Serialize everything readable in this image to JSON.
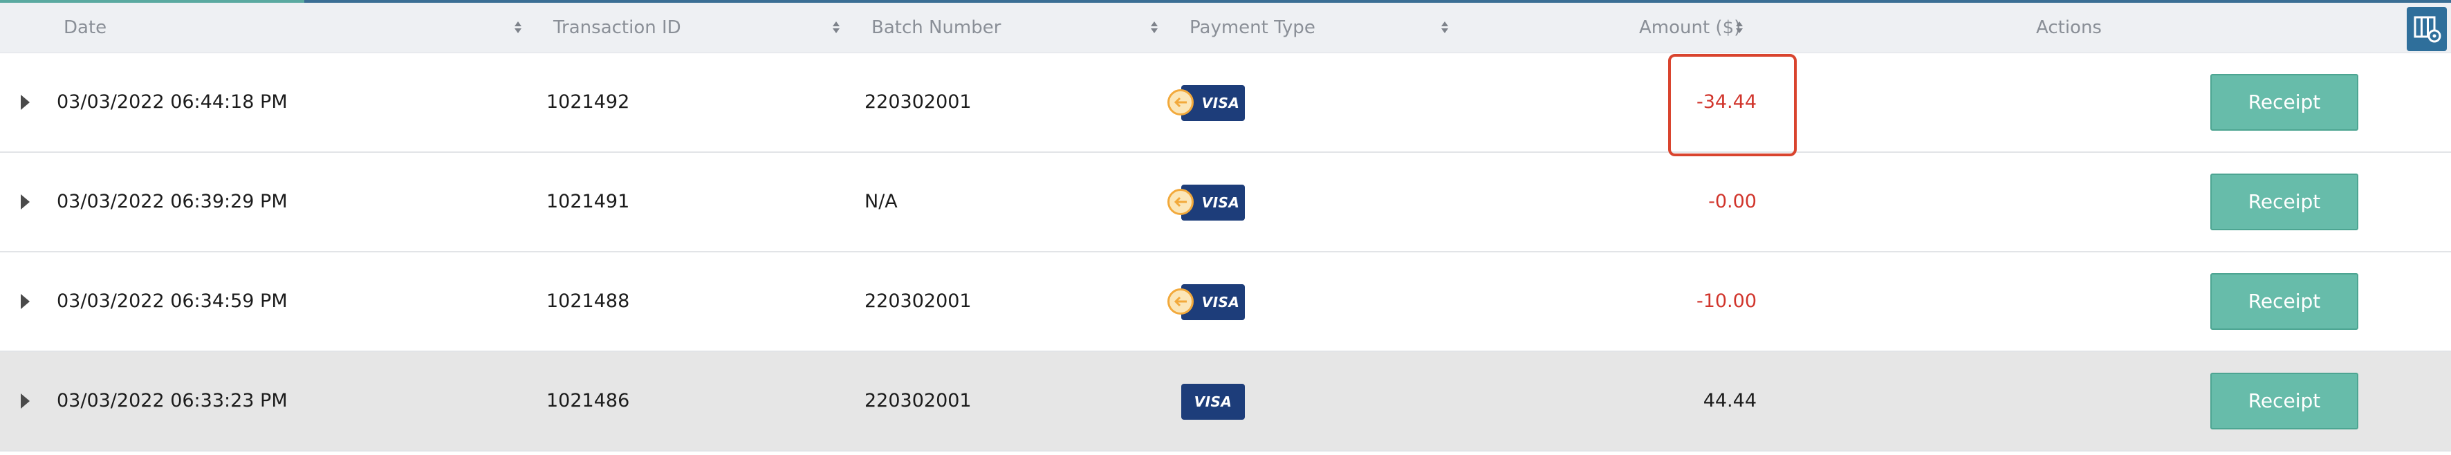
{
  "header": {
    "date": "Date",
    "transaction_id": "Transaction ID",
    "batch_number": "Batch Number",
    "payment_type": "Payment Type",
    "amount": "Amount ($)",
    "actions": "Actions"
  },
  "icons": {
    "sort": "sort-arrows-icon",
    "column_settings": "column-settings-icon",
    "expand": "expand-row-caret-icon",
    "refund": "refund-arrow-icon",
    "card": "visa-card-icon"
  },
  "colors": {
    "negative_amount": "#d1352c",
    "receipt_button": "#67bcaa",
    "highlight_box": "#d9442e",
    "visa_blue": "#1d3d7a",
    "header_bar": "#2f6f9b"
  },
  "rows": [
    {
      "date": "03/03/2022 06:44:18 PM",
      "transaction_id": "1021492",
      "batch_number": "220302001",
      "card": "VISA",
      "refund": true,
      "amount": "-34.44",
      "action": "Receipt"
    },
    {
      "date": "03/03/2022 06:39:29 PM",
      "transaction_id": "1021491",
      "batch_number": "N/A",
      "card": "VISA",
      "refund": true,
      "amount": "-0.00",
      "action": "Receipt"
    },
    {
      "date": "03/03/2022 06:34:59 PM",
      "transaction_id": "1021488",
      "batch_number": "220302001",
      "card": "VISA",
      "refund": true,
      "amount": "-10.00",
      "action": "Receipt"
    },
    {
      "date": "03/03/2022 06:33:23 PM",
      "transaction_id": "1021486",
      "batch_number": "220302001",
      "card": "VISA",
      "refund": false,
      "amount": "44.44",
      "action": "Receipt"
    }
  ]
}
